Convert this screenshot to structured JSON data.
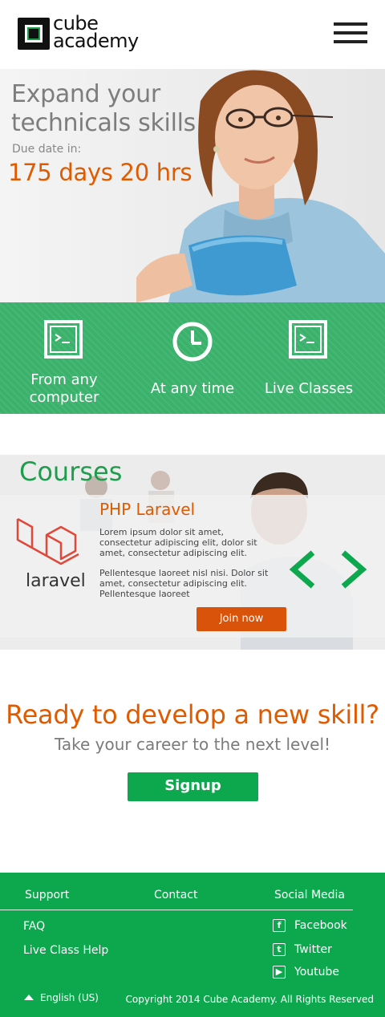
{
  "header": {
    "logo_line1": "cube",
    "logo_line2": "academy"
  },
  "hero": {
    "title": "Expand your technicals skills",
    "due_label": "Due date in:",
    "countdown": "175 days  20 hrs"
  },
  "features": [
    {
      "label": "From any computer",
      "icon": "terminal-icon"
    },
    {
      "label": "At any time",
      "icon": "clock-icon"
    },
    {
      "label": "Live Classes",
      "icon": "terminal-icon"
    }
  ],
  "courses": {
    "title": "Courses",
    "course_name": "PHP Laravel",
    "logo_text": "laravel",
    "desc1": "Lorem ipsum dolor sit amet, consectetur adipiscing elit, dolor sit amet, consectetur adipiscing elit.",
    "desc2": "Pellentesque laoreet nisl nisi. Dolor sit amet, consectetur adipiscing elit. Pellentesque laoreet",
    "join_label": "Join now"
  },
  "cta": {
    "title": "Ready to develop a new skill?",
    "subtitle": "Take your career to the next level!",
    "signup_label": "Signup"
  },
  "footer": {
    "support_heading": "Support",
    "contact_heading": "Contact",
    "social_heading": "Social Media",
    "support_links": [
      "FAQ",
      "Live Class Help"
    ],
    "social_links": [
      {
        "label": "Facebook",
        "icon": "facebook-icon"
      },
      {
        "label": "Twitter",
        "icon": "twitter-icon"
      },
      {
        "label": "Youtube",
        "icon": "youtube-icon"
      }
    ],
    "language": "English (US)",
    "copyright": "Copyright 2014 Cube Academy. All Rights Reserved"
  },
  "colors": {
    "brand_green": "#0da84e",
    "accent_orange": "#e05a00",
    "feature_band": "#3ab26c"
  }
}
